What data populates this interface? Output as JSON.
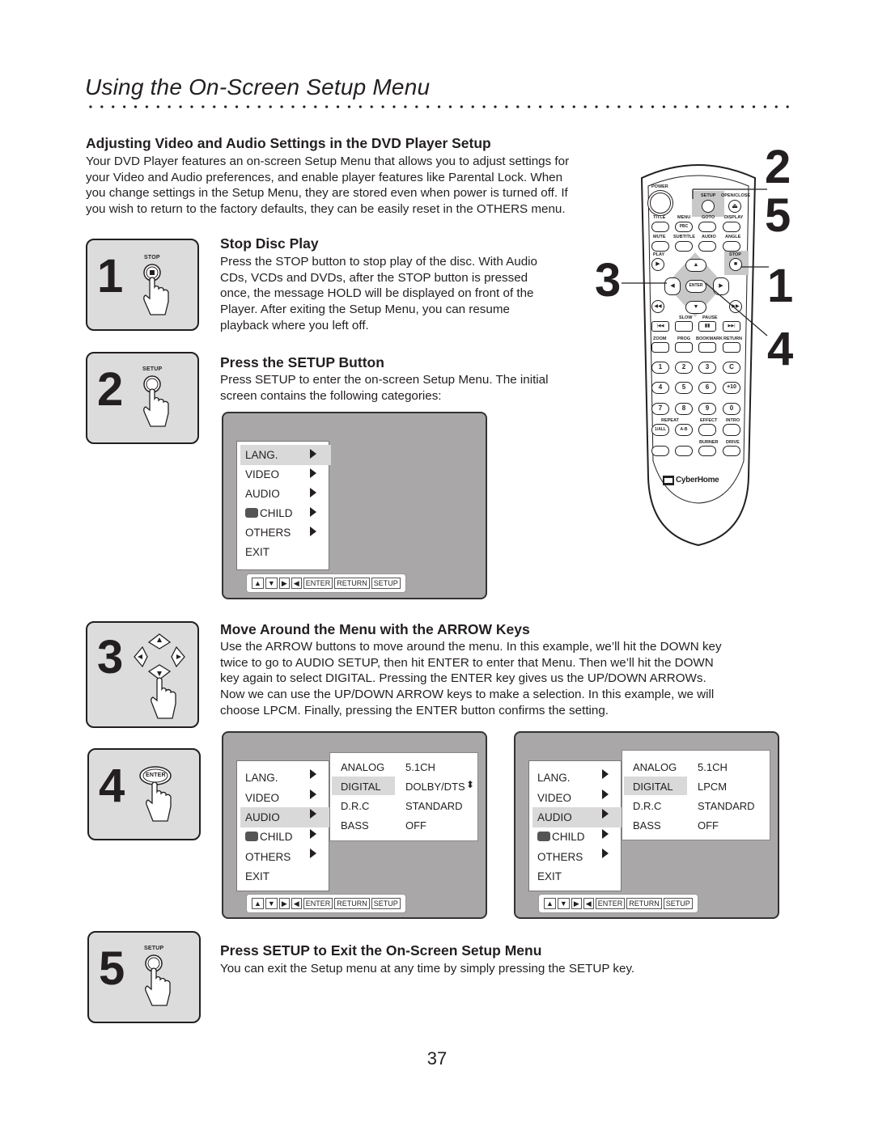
{
  "page": {
    "title": "Using the On-Screen Setup Menu",
    "page_number": "37"
  },
  "intro": {
    "heading": "Adjusting Video and Audio Settings in the DVD Player Setup",
    "lines": [
      "Your DVD Player features an on-screen Setup Menu that allows you to adjust settings for",
      "your Video and Audio preferences, and enable player features like Parental Lock. When",
      "you change settings in the Setup Menu, they are stored even when power is turned off. If",
      "you wish to return to the factory defaults, they can be easily reset in the OTHERS menu."
    ]
  },
  "steps": [
    {
      "number": "1",
      "button_label": "STOP",
      "heading": "Stop Disc Play",
      "lines": [
        "Press the STOP button to stop play of the disc. With Audio",
        "CDs, VCDs and DVDs, after the STOP button is pressed",
        "once, the message HOLD will be displayed on front of the",
        "Player. After exiting the Setup Menu, you can resume",
        "playback where you left off."
      ]
    },
    {
      "number": "2",
      "button_label": "SETUP",
      "heading": "Press the SETUP Button",
      "lines": [
        "Press SETUP to enter the on-screen Setup Menu. The initial",
        "screen contains the following categories:"
      ]
    },
    {
      "number": "3",
      "button_label": "",
      "heading": "Move Around the Menu with the ARROW Keys",
      "lines": [
        "Use the ARROW buttons to move around the menu. In this example, we’ll hit the DOWN key",
        "twice to go to AUDIO SETUP, then hit ENTER to enter that Menu. Then we’ll hit the DOWN",
        "key again to select DIGITAL. Pressing the ENTER key gives us the UP/DOWN ARROWs.",
        "Now we can use the UP/DOWN ARROW keys to make a selection. In this example, we will",
        "choose LPCM. Finally, pressing the ENTER button confirms the setting."
      ]
    },
    {
      "number": "4",
      "button_label": "ENTER",
      "heading": "",
      "lines": []
    },
    {
      "number": "5",
      "button_label": "SETUP",
      "heading": "Press SETUP to Exit the On-Screen Setup Menu",
      "lines": [
        "You can exit the Setup menu at any time by simply pressing the SETUP key."
      ]
    }
  ],
  "menu": {
    "items": [
      "LANG.",
      "VIDEO",
      "AUDIO",
      "CHILD",
      "OTHERS",
      "EXIT"
    ],
    "keys": [
      "▲",
      "▼",
      "▶",
      "◀",
      "ENTER",
      "RETURN",
      "SETUP"
    ]
  },
  "screens": [
    {
      "selected_main": "LANG.",
      "submenu": null
    },
    {
      "selected_main": "AUDIO",
      "submenu": {
        "labels": [
          "ANALOG",
          "DIGITAL",
          "D.R.C",
          "BASS"
        ],
        "values": [
          "5.1CH",
          "DOLBY/DTS",
          "STANDARD",
          "OFF"
        ],
        "selected": "DIGITAL",
        "updown_indicator": "⬍"
      }
    },
    {
      "selected_main": "AUDIO",
      "submenu": {
        "labels": [
          "ANALOG",
          "DIGITAL",
          "D.R.C",
          "BASS"
        ],
        "values": [
          "5.1CH",
          "LPCM",
          "STANDARD",
          "OFF"
        ],
        "selected": "DIGITAL"
      }
    }
  ],
  "remote": {
    "brand": "CyberHome",
    "callouts": [
      "2",
      "5",
      "3",
      "1",
      "4"
    ],
    "labels": {
      "power": "POWER",
      "setup": "SETUP",
      "open_close": "OPEN/CLOSE",
      "title": "TITLE",
      "menu": "MENU",
      "pbc": "PBC",
      "goto": "GOTO",
      "display": "DISPLAY",
      "mute": "MUTE",
      "subtitle": "SUBTITLE",
      "audio": "AUDIO",
      "angle": "ANGLE",
      "play": "PLAY",
      "stop": "STOP",
      "enter": "ENTER",
      "slow": "SLOW",
      "pause": "PAUSE",
      "zoom": "ZOOM",
      "prog": "PROG",
      "bookmark": "BOOKMARK",
      "return": "RETURN",
      "repeat": "REPEAT",
      "one_all": "1/ALL",
      "a_b": "A-B",
      "effect": "EFFECT",
      "intro": "INTRO",
      "burner": "BURNER",
      "drive": "DRIVE"
    },
    "numpad": [
      "1",
      "2",
      "3",
      "C",
      "4",
      "5",
      "6",
      "+10",
      "7",
      "8",
      "9",
      "0"
    ]
  }
}
